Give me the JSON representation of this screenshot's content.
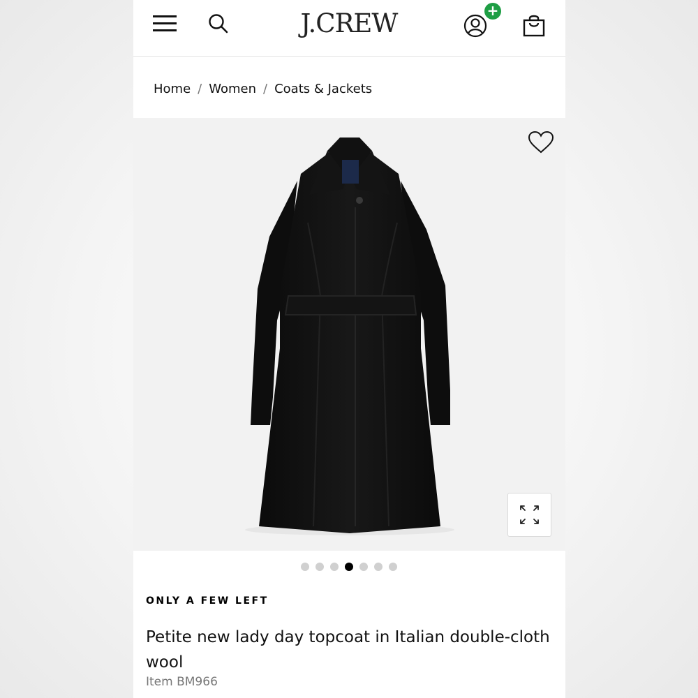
{
  "header": {
    "logo": "J.CREW",
    "icons": [
      "menu-icon",
      "search-icon",
      "account-icon",
      "plus-badge",
      "bag-icon"
    ],
    "badge_symbol": "+"
  },
  "breadcrumb": {
    "items": [
      "Home",
      "Women",
      "Coats & Jackets"
    ],
    "separator": "/"
  },
  "product": {
    "stock_label": "ONLY A FEW LEFT",
    "title": "Petite new lady day topcoat in Italian double-cloth wool",
    "item_number": "Item BM966"
  },
  "carousel": {
    "total": 7,
    "active_index": 3
  },
  "colors": {
    "accent_green": "#1e9e44",
    "image_background": "#f2f2f2",
    "coat": "#111111"
  }
}
